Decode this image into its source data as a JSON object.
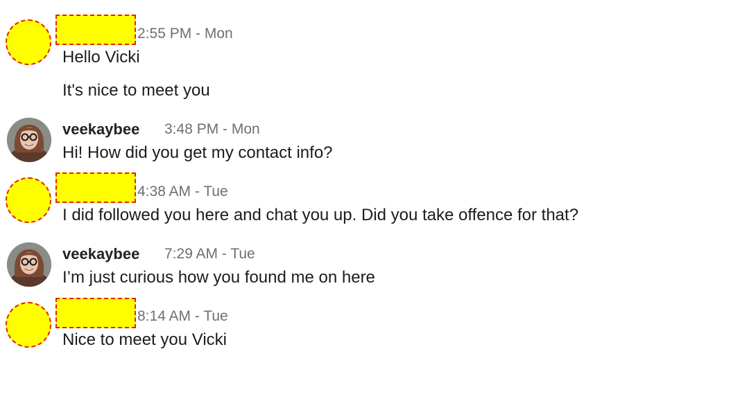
{
  "messages": [
    {
      "author": "",
      "author_redacted": true,
      "time": "2:55 PM - Mon",
      "lines": [
        "Hello Vicki",
        "It's nice to meet you"
      ]
    },
    {
      "author": "veekaybee",
      "author_redacted": false,
      "time": "3:48 PM - Mon",
      "lines": [
        "Hi! How did you get my contact info?"
      ]
    },
    {
      "author": "",
      "author_redacted": true,
      "time": "4:38 AM - Tue",
      "lines": [
        "I did followed you here and chat you up. Did you take offence for that?"
      ]
    },
    {
      "author": "veekaybee",
      "author_redacted": false,
      "time": "7:29 AM - Tue",
      "lines": [
        "I’m just curious how you found me on here"
      ]
    },
    {
      "author": "",
      "author_redacted": true,
      "time": "8:14 AM - Tue",
      "lines": [
        "Nice to meet you Vicki"
      ]
    }
  ],
  "colors": {
    "redaction_fill": "#ffff00",
    "redaction_border": "#e02020",
    "timestamp": "#6f6f6f",
    "text": "#1c1c1c"
  },
  "icons": {
    "avatar_photo": "user-photo-avatar-icon",
    "avatar_redacted": "redacted-avatar-icon"
  }
}
